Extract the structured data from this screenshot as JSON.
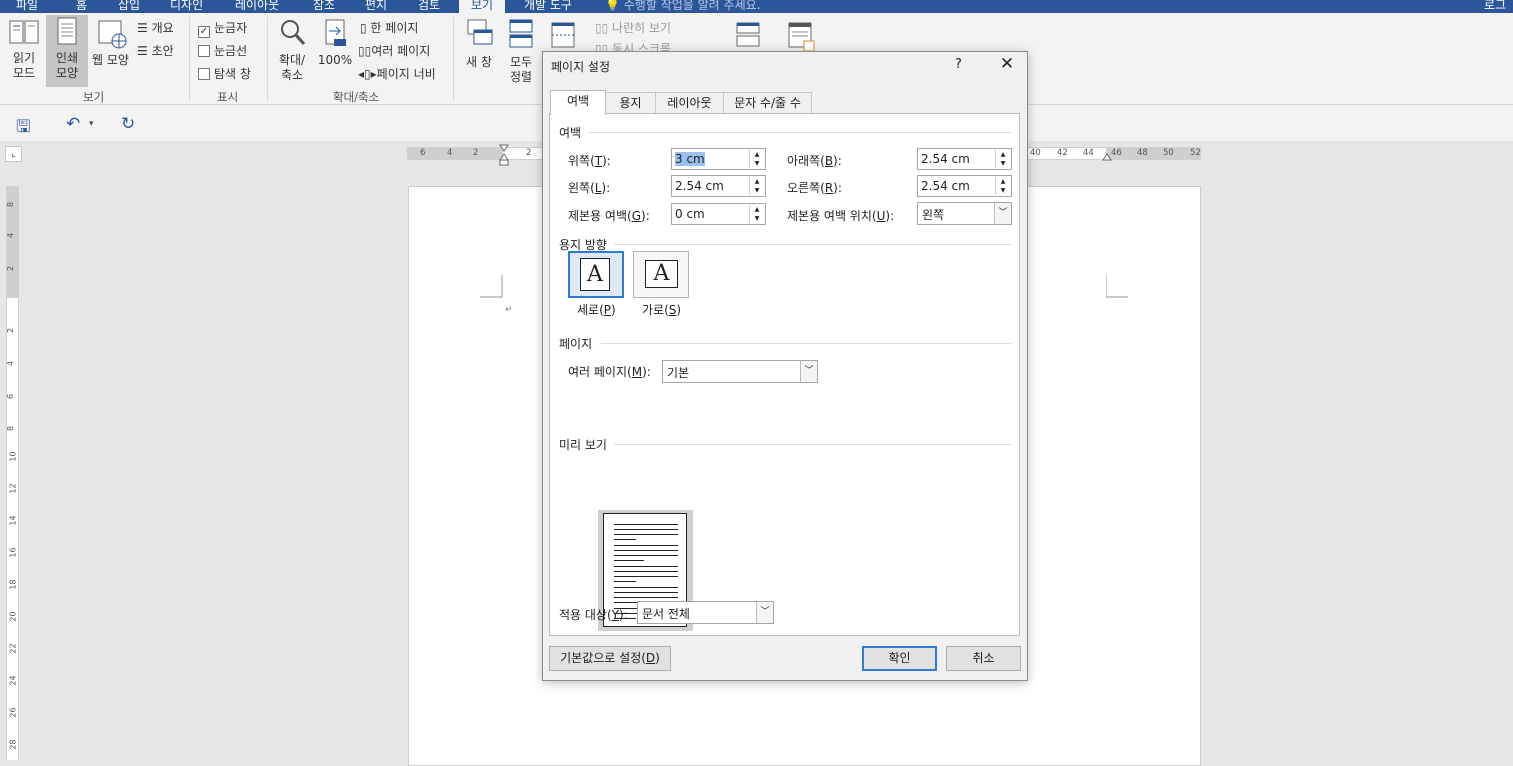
{
  "ribbon_tabs": [
    {
      "label": "파일"
    },
    {
      "label": "홈"
    },
    {
      "label": "삽입"
    },
    {
      "label": "디자인"
    },
    {
      "label": "레이아웃"
    },
    {
      "label": "참조"
    },
    {
      "label": "편지"
    },
    {
      "label": "검토"
    },
    {
      "label": "보기"
    },
    {
      "label": "개발 도구"
    }
  ],
  "tell_me": "수행할 작업을 알려 주세요.",
  "signin": "로그",
  "ribbon": {
    "read_mode": "읽기\n모드",
    "print_layout": "인쇄\n모양",
    "web_layout": "웹 모양",
    "outline": "개요",
    "draft": "초안",
    "group_views": "보기",
    "ruler": "눈금자",
    "gridlines": "눈금선",
    "nav_pane": "탐색 창",
    "group_show": "표시",
    "zoom": "확대/\n축소",
    "zoom_100": "100%",
    "one_page": "한 페이지",
    "multiple_pages": "여러 페이지",
    "page_width": "페이지 너비",
    "group_zoom": "확대/축소",
    "new_window": "새 창",
    "arrange_all": "모두\n정렬",
    "side_by_side": "나란히 보기",
    "sync_scroll": "동시 스크롤"
  },
  "ruler_numbers": [
    "6",
    "4",
    "2",
    "2",
    "40",
    "42",
    "44",
    "46",
    "48",
    "50",
    "52"
  ],
  "vruler_numbers": [
    "8",
    "4",
    "2",
    "2",
    "4",
    "6",
    "8",
    "10",
    "12",
    "14",
    "16",
    "18",
    "20",
    "22",
    "24",
    "26",
    "28"
  ],
  "dialog": {
    "title": "페이지 설정",
    "help": "?",
    "close": "✕",
    "tabs": [
      "여백",
      "용지",
      "레이아웃",
      "문자 수/줄 수"
    ],
    "margins_section": "여백",
    "top_label": "위쪽(T):",
    "top_key": "T",
    "top_value": "3 cm",
    "bottom_label": "아래쪽(B):",
    "bottom_value": "2.54 cm",
    "left_label": "왼쪽(L):",
    "left_value": "2.54 cm",
    "right_label": "오른쪽(R):",
    "right_value": "2.54 cm",
    "gutter_label": "제본용 여백(G):",
    "gutter_value": "0 cm",
    "gutter_pos_label": "제본용 여백 위치(U):",
    "gutter_pos_value": "왼쪽",
    "orientation_section": "용지 방향",
    "portrait": "세로(P)",
    "landscape": "가로(S)",
    "pages_section": "페이지",
    "multiple_pages_label": "여러 페이지(M):",
    "multiple_pages_value": "기본",
    "preview_section": "미리 보기",
    "apply_to_label": "적용 대상(Y):",
    "apply_to_value": "문서 전체",
    "set_default": "기본값으로 설정(D)",
    "ok": "확인",
    "cancel": "취소"
  }
}
